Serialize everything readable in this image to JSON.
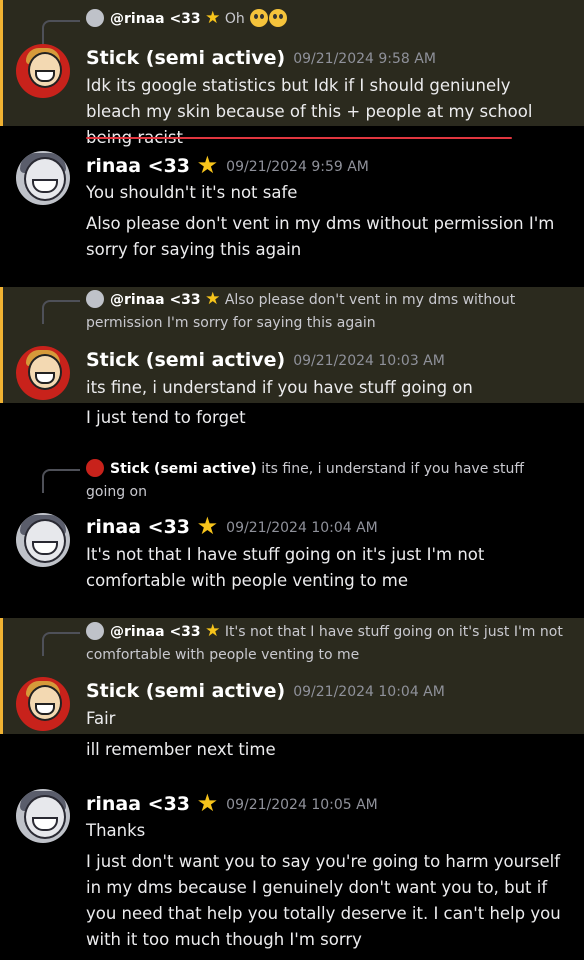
{
  "users": {
    "stick": {
      "name": "Stick (semi active)"
    },
    "rinaa": {
      "name": "rinaa <33",
      "star": "★"
    }
  },
  "colors": {
    "highlight": "#2b2a1e",
    "mention_bar": "#f0b232",
    "timestamp": "#8f919a",
    "underline": "#e0363f"
  },
  "messages": [
    {
      "reply": {
        "name": "@rinaa <33",
        "text": "Oh",
        "emoji": [
          "fearful-face",
          "fearful-face"
        ]
      },
      "author": "Stick (semi active)",
      "timestamp": "09/21/2024 9:58 AM",
      "lines": [
        "Idk its google statistics but Idk if I should geniunely bleach my skin because of this + people at my school being racist"
      ]
    },
    {
      "author": "rinaa <33",
      "timestamp": "09/21/2024 9:59 AM",
      "lines": [
        "You shouldn't it's not safe",
        "Also please don't vent in my dms without permission I'm sorry for saying this again"
      ]
    },
    {
      "reply": {
        "name": "@rinaa <33",
        "text": "Also please don't vent in my dms without permission I'm sorry for saying this again"
      },
      "author": "Stick (semi active)",
      "timestamp": "09/21/2024 10:03 AM",
      "lines": [
        "its fine, i understand if you have stuff going on",
        "I just tend to forget"
      ]
    },
    {
      "reply": {
        "name": "Stick (semi active)",
        "text": "its fine, i understand if you have stuff going on"
      },
      "author": "rinaa <33",
      "timestamp": "09/21/2024 10:04 AM",
      "lines": [
        "It's not that I have stuff going on it's just I'm not comfortable with people venting to me"
      ]
    },
    {
      "reply": {
        "name": "@rinaa <33",
        "text": "It's not that I have stuff going on it's just I'm not comfortable with people venting to me"
      },
      "author": "Stick (semi active)",
      "timestamp": "09/21/2024 10:04 AM",
      "lines": [
        "Fair",
        "ill remember next time"
      ]
    },
    {
      "author": "rinaa <33",
      "timestamp": "09/21/2024 10:05 AM",
      "lines": [
        "Thanks",
        "I just don't want you to say you're going to harm yourself in my dms because I genuinely don't want you to, but if you need that help you totally deserve it. I can't help you with it too much though I'm sorry"
      ]
    }
  ]
}
